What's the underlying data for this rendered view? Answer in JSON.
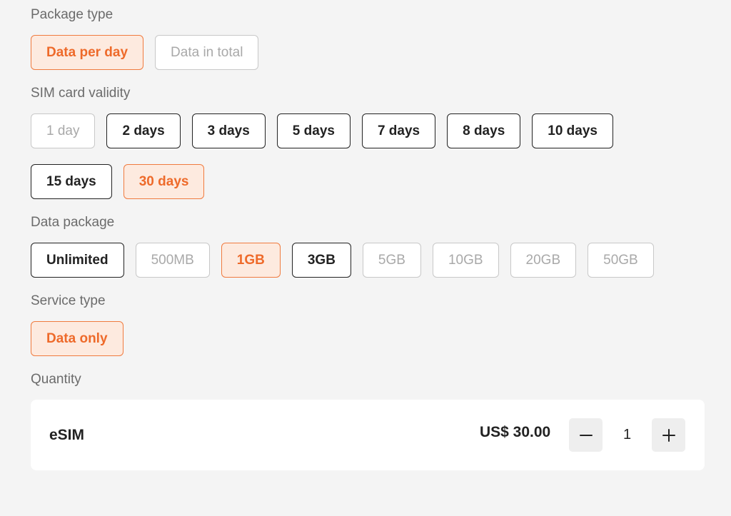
{
  "package_type": {
    "label": "Package type",
    "options": [
      {
        "label": "Data per day",
        "state": "selected"
      },
      {
        "label": "Data in total",
        "state": "disabled"
      }
    ]
  },
  "sim_validity": {
    "label": "SIM card validity",
    "options": [
      {
        "label": "1 day",
        "state": "disabled"
      },
      {
        "label": "2 days",
        "state": "normal"
      },
      {
        "label": "3 days",
        "state": "normal"
      },
      {
        "label": "5 days",
        "state": "normal"
      },
      {
        "label": "7 days",
        "state": "normal"
      },
      {
        "label": "8 days",
        "state": "normal"
      },
      {
        "label": "10 days",
        "state": "normal"
      },
      {
        "label": "15 days",
        "state": "normal"
      },
      {
        "label": "30 days",
        "state": "selected"
      }
    ]
  },
  "data_package": {
    "label": "Data package",
    "options": [
      {
        "label": "Unlimited",
        "state": "normal"
      },
      {
        "label": "500MB",
        "state": "disabled"
      },
      {
        "label": "1GB",
        "state": "selected"
      },
      {
        "label": "3GB",
        "state": "normal"
      },
      {
        "label": "5GB",
        "state": "disabled"
      },
      {
        "label": "10GB",
        "state": "disabled"
      },
      {
        "label": "20GB",
        "state": "disabled"
      },
      {
        "label": "50GB",
        "state": "disabled"
      }
    ]
  },
  "service_type": {
    "label": "Service type",
    "options": [
      {
        "label": "Data only",
        "state": "selected"
      }
    ]
  },
  "quantity": {
    "label": "Quantity",
    "item_name": "eSIM",
    "price": "US$ 30.00",
    "value": "1",
    "decrement_icon": "minus-icon",
    "increment_icon": "plus-icon"
  },
  "colors": {
    "accent": "#ee6a2a",
    "accent_bg": "#fdeadf",
    "background": "#f4f4f4"
  }
}
